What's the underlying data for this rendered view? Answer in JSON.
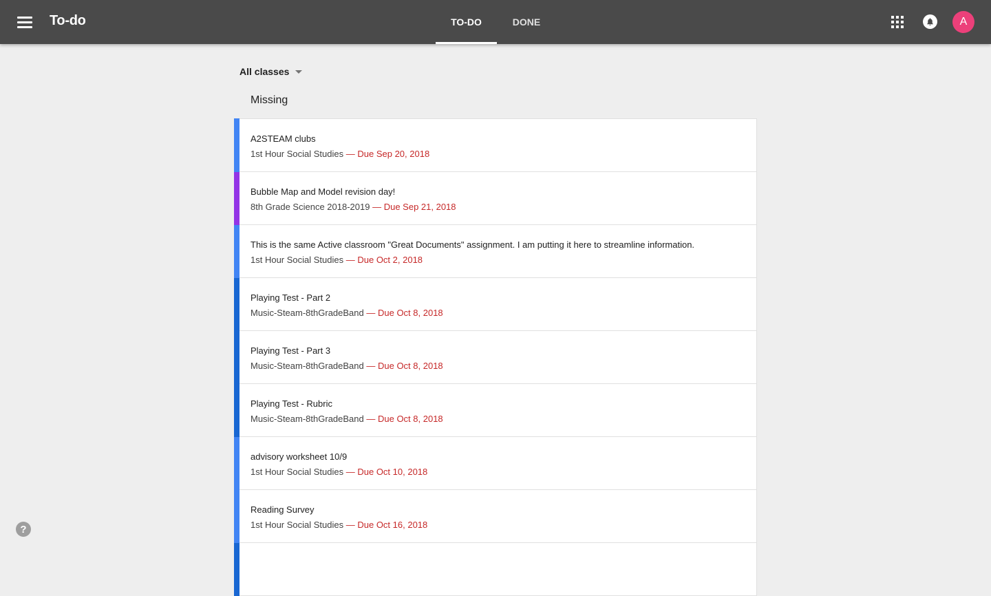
{
  "appbar": {
    "title": "To-do",
    "tabs": [
      {
        "label": "TO-DO",
        "active": true
      },
      {
        "label": "DONE",
        "active": false
      }
    ],
    "avatar_letter": "A",
    "avatar_color": "#ec407a",
    "icons": [
      "menu-icon",
      "apps-icon",
      "bell-icon"
    ]
  },
  "filter": {
    "selected": "All classes"
  },
  "section": {
    "heading": "Missing"
  },
  "items": [
    {
      "title": "A2STEAM clubs",
      "class": "1st Hour Social Studies",
      "due": "— Due Sep 20, 2018",
      "color": "#4285f4"
    },
    {
      "title": "Bubble Map and Model revision day!",
      "class": "8th Grade Science 2018-2019",
      "due": "— Due Sep 21, 2018",
      "color": "#9334e6"
    },
    {
      "title": "This is the same Active classroom \"Great Documents\" assignment. I am putting it here to streamline information.",
      "class": "1st Hour Social Studies",
      "due": "— Due Oct 2, 2018",
      "color": "#4285f4"
    },
    {
      "title": "Playing Test - Part 2",
      "class": "Music-Steam-8thGradeBand",
      "due": "— Due Oct 8, 2018",
      "color": "#1967d2"
    },
    {
      "title": "Playing Test - Part 3",
      "class": "Music-Steam-8thGradeBand",
      "due": "— Due Oct 8, 2018",
      "color": "#1967d2"
    },
    {
      "title": "Playing Test - Rubric",
      "class": "Music-Steam-8thGradeBand",
      "due": "— Due Oct 8, 2018",
      "color": "#1967d2"
    },
    {
      "title": "advisory worksheet 10/9",
      "class": "1st Hour Social Studies",
      "due": "— Due Oct 10, 2018",
      "color": "#4285f4"
    },
    {
      "title": "Reading Survey",
      "class": "1st Hour Social Studies",
      "due": "— Due Oct 16, 2018",
      "color": "#4285f4"
    },
    {
      "title": "",
      "class": "",
      "due": "",
      "color": "#1967d2"
    }
  ],
  "help": {
    "label": "?"
  }
}
